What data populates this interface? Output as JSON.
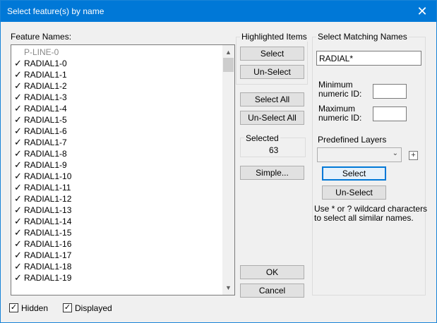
{
  "window": {
    "title": "Select feature(s) by name",
    "close_glyph": "✕"
  },
  "feature_names": {
    "label": "Feature Names:",
    "items": [
      {
        "label": "P-LINE-0",
        "checked": false,
        "greyed": true
      },
      {
        "label": "RADIAL1-0",
        "checked": true
      },
      {
        "label": "RADIAL1-1",
        "checked": true
      },
      {
        "label": "RADIAL1-2",
        "checked": true
      },
      {
        "label": "RADIAL1-3",
        "checked": true
      },
      {
        "label": "RADIAL1-4",
        "checked": true
      },
      {
        "label": "RADIAL1-5",
        "checked": true
      },
      {
        "label": "RADIAL1-6",
        "checked": true
      },
      {
        "label": "RADIAL1-7",
        "checked": true
      },
      {
        "label": "RADIAL1-8",
        "checked": true
      },
      {
        "label": "RADIAL1-9",
        "checked": true
      },
      {
        "label": "RADIAL1-10",
        "checked": true
      },
      {
        "label": "RADIAL1-11",
        "checked": true
      },
      {
        "label": "RADIAL1-12",
        "checked": true
      },
      {
        "label": "RADIAL1-13",
        "checked": true
      },
      {
        "label": "RADIAL1-14",
        "checked": true
      },
      {
        "label": "RADIAL1-15",
        "checked": true
      },
      {
        "label": "RADIAL1-16",
        "checked": true
      },
      {
        "label": "RADIAL1-17",
        "checked": true
      },
      {
        "label": "RADIAL1-18",
        "checked": true
      },
      {
        "label": "RADIAL1-19",
        "checked": true
      }
    ]
  },
  "highlighted": {
    "title": "Highlighted Items",
    "select_label": "Select",
    "unselect_label": "Un-Select"
  },
  "select_all_label": "Select All",
  "unselect_all_label": "Un-Select All",
  "selected": {
    "label": "Selected",
    "count": "63"
  },
  "simple_label": "Simple...",
  "ok_label": "OK",
  "cancel_label": "Cancel",
  "matching": {
    "title": "Select Matching Names",
    "name_value": "RADIAL*",
    "min_id_label_1": "Minimum",
    "min_id_label_2": "numeric ID:",
    "min_id_value": "",
    "max_id_label_1": "Maximum",
    "max_id_label_2": "numeric ID:",
    "max_id_value": "",
    "predefined_label": "Predefined Layers",
    "predefined_value": "",
    "plus_glyph": "+",
    "select_label": "Select",
    "unselect_label": "Un-Select",
    "hint_1": "Use * or ? wildcard characters",
    "hint_2": "to select all similar names."
  },
  "footer": {
    "hidden_label": "Hidden",
    "hidden_checked": true,
    "displayed_label": "Displayed",
    "displayed_checked": true
  },
  "icons": {
    "check": "✓",
    "scroll_up": "▲",
    "scroll_down": "▼",
    "combo_arrow": "⌄"
  }
}
